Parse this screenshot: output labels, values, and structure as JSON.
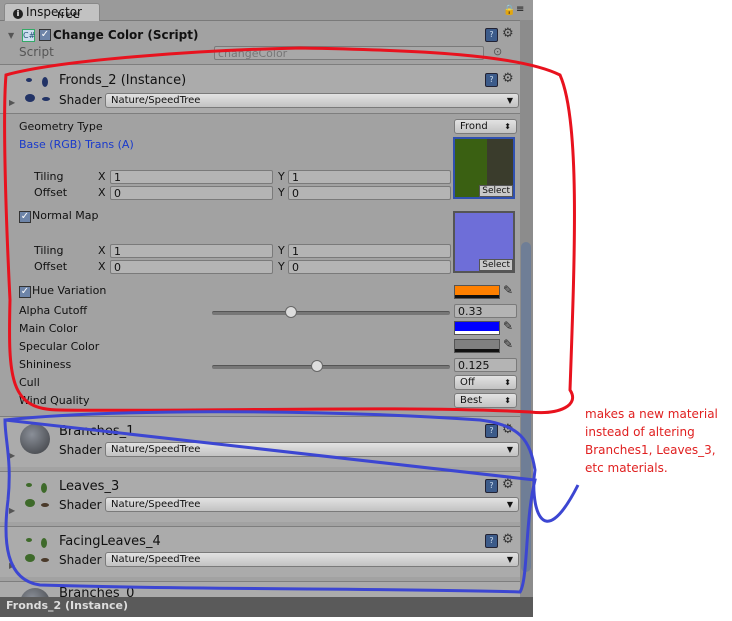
{
  "tab": {
    "title": "Inspector"
  },
  "partial_top": {
    "label": "Tree"
  },
  "component": {
    "title": "Change Color (Script)",
    "script_label": "Script",
    "script_value": "changeColor"
  },
  "material": {
    "name": "Fronds_2 (Instance)",
    "shader_label": "Shader",
    "shader": "Nature/SpeedTree",
    "geometry_type_label": "Geometry Type",
    "geometry_type": "Frond",
    "base_label": "Base (RGB) Trans (A)",
    "base": {
      "tiling_label": "Tiling",
      "offset_label": "Offset",
      "tx": "1",
      "ty": "1",
      "ox": "0",
      "oy": "0"
    },
    "normal_label": "Normal Map",
    "normal": {
      "tiling_label": "Tiling",
      "offset_label": "Offset",
      "tx": "1",
      "ty": "1",
      "ox": "0",
      "oy": "0"
    },
    "x": "X",
    "y": "Y",
    "select": "Select",
    "hue_label": "Hue Variation",
    "hue_color": "#ff8000",
    "alpha_label": "Alpha Cutoff",
    "alpha_value": "0.33",
    "alpha_fraction": 0.33,
    "main_color_label": "Main Color",
    "main_color": "#0000ff",
    "specular_label": "Specular Color",
    "specular_color": "#808080",
    "shininess_label": "Shininess",
    "shininess_value": "0.125",
    "shininess_fraction": 0.44,
    "cull_label": "Cull",
    "cull": "Off",
    "wind_label": "Wind Quality",
    "wind": "Best"
  },
  "others": [
    {
      "name": "Branches_1",
      "shader_label": "Shader",
      "shader": "Nature/SpeedTree"
    },
    {
      "name": "Leaves_3",
      "shader_label": "Shader",
      "shader": "Nature/SpeedTree"
    },
    {
      "name": "FacingLeaves_4",
      "shader_label": "Shader",
      "shader": "Nature/SpeedTree"
    },
    {
      "name": "Branches_0"
    }
  ],
  "footer": {
    "title": "Fronds_2 (Instance)"
  },
  "annotation": {
    "text": "makes a new material instead of altering Branches1, Leaves_3, etc materials.",
    "red": "#e8121e",
    "blue": "#3c46d2"
  }
}
